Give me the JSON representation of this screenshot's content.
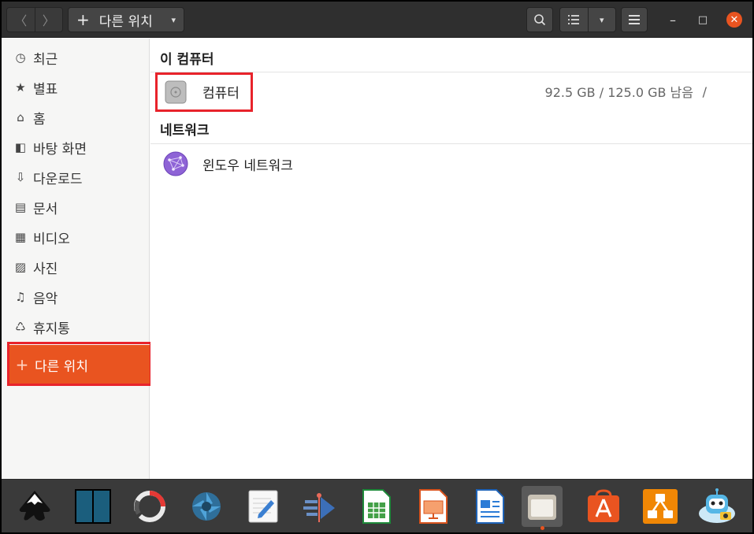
{
  "header": {
    "back_glyph": "〈",
    "forward_glyph": "〉",
    "path_plus": "+",
    "path_label": "다른 위치",
    "caret": "▾",
    "minimize_glyph": "–",
    "maximize_glyph": "□",
    "close_glyph": "✕"
  },
  "sidebar": {
    "items": [
      {
        "label": "최근",
        "icon": "clock-icon",
        "glyph": "◷"
      },
      {
        "label": "별표",
        "icon": "star-icon",
        "glyph": "★"
      },
      {
        "label": "홈",
        "icon": "home-icon",
        "glyph": "⌂"
      },
      {
        "label": "바탕 화면",
        "icon": "desktop-icon",
        "glyph": "◧"
      },
      {
        "label": "다운로드",
        "icon": "download-icon",
        "glyph": "⇩"
      },
      {
        "label": "문서",
        "icon": "document-icon",
        "glyph": "▤"
      },
      {
        "label": "비디오",
        "icon": "video-icon",
        "glyph": "▦"
      },
      {
        "label": "사진",
        "icon": "picture-icon",
        "glyph": "▨"
      },
      {
        "label": "음악",
        "icon": "music-icon",
        "glyph": "♫"
      },
      {
        "label": "휴지통",
        "icon": "trash-icon",
        "glyph": "♺"
      }
    ],
    "active": {
      "label": "다른 위치",
      "icon": "plus-icon",
      "glyph": "+"
    }
  },
  "main": {
    "section_computer": "이 컴퓨터",
    "computer": {
      "label": "컴퓨터",
      "usage": "92.5 GB / 125.0 GB 남음",
      "mount": "/"
    },
    "section_network": "네트워크",
    "network": {
      "label": "윈도우 네트워크"
    }
  },
  "dock": {
    "apps": [
      "inkscape-icon",
      "bookshelf-icon",
      "loader-icon",
      "shutter-icon",
      "text-editor-icon",
      "nav-arrow-icon",
      "calc-spreadsheet-icon",
      "impress-presentation-icon",
      "writer-document-icon",
      "files-icon",
      "software-store-icon",
      "diagram-icon",
      "robot-app-icon"
    ],
    "running": "files-icon"
  },
  "colors": {
    "accent": "#e95420",
    "highlight": "#e8232b",
    "header": "#2f2f2f"
  }
}
